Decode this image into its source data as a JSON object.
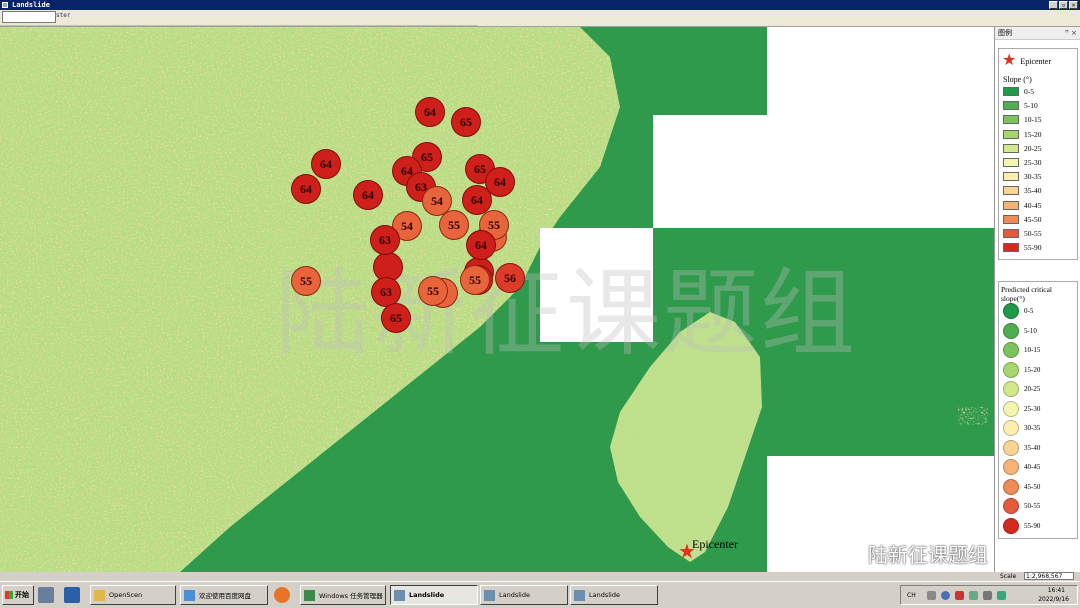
{
  "window": {
    "title": "Landslide",
    "controls": [
      "_",
      "▫",
      "×"
    ]
  },
  "toolbar": {
    "field_text": "ster"
  },
  "map": {
    "epicenter_label": "Epicenter",
    "watermark": "陆新征课题组",
    "brand": "陆新征课题组",
    "markers": [
      {
        "label": "64",
        "color": "#cf1f1a"
      },
      {
        "label": "65",
        "color": "#cf1f1a"
      },
      {
        "label": "65",
        "color": "#cf1f1a"
      },
      {
        "label": "64",
        "color": "#cf1f1a"
      },
      {
        "label": "64",
        "color": "#cf1f1a"
      },
      {
        "label": "65",
        "color": "#cf1f1a"
      },
      {
        "label": "64",
        "color": "#cf1f1a"
      },
      {
        "label": "64",
        "color": "#cf1f1a"
      },
      {
        "label": "64",
        "color": "#cf1f1a"
      },
      {
        "label": "63",
        "color": "#cf1f1a"
      },
      {
        "label": "54",
        "color": "#e8643a"
      },
      {
        "label": "64",
        "color": "#cf1f1a"
      },
      {
        "label": "54",
        "color": "#e8643a"
      },
      {
        "label": "55",
        "color": "#e8643a"
      },
      {
        "label": "55",
        "color": "#e8643a"
      },
      {
        "label": "63",
        "color": "#cf1f1a"
      },
      {
        "label": "64",
        "color": "#cf1f1a"
      },
      {
        "label": "55",
        "color": "#e8643a"
      },
      {
        "label": "55",
        "color": "#e8643a"
      },
      {
        "label": "56",
        "color": "#dd3a2a"
      },
      {
        "label": "63",
        "color": "#cf1f1a"
      },
      {
        "label": "55",
        "color": "#e8643a"
      },
      {
        "label": "65",
        "color": "#cf1f1a"
      }
    ]
  },
  "legend": {
    "panel_title": "图例",
    "panel_controls": "ꟸ ×",
    "epicenter_label": "Epicenter",
    "slope_title": "Slope (°)",
    "slope_items": [
      {
        "label": "0-5",
        "color": "#1e9a48"
      },
      {
        "label": "5-10",
        "color": "#4fae4f"
      },
      {
        "label": "10-15",
        "color": "#7cc35e"
      },
      {
        "label": "15-20",
        "color": "#a8d66e"
      },
      {
        "label": "20-25",
        "color": "#d2e88a"
      },
      {
        "label": "25-30",
        "color": "#f3f5b0"
      },
      {
        "label": "30-35",
        "color": "#fdefb0"
      },
      {
        "label": "35-40",
        "color": "#fbd393"
      },
      {
        "label": "40-45",
        "color": "#f6b277"
      },
      {
        "label": "45-50",
        "color": "#ee8b58"
      },
      {
        "label": "50-55",
        "color": "#e45a3c"
      },
      {
        "label": "55-90",
        "color": "#d42a22"
      }
    ],
    "pc_title": "Predicted critical slope(°)",
    "pc_items": [
      {
        "label": "0-5",
        "color": "#1e9a48"
      },
      {
        "label": "5-10",
        "color": "#4fae4f"
      },
      {
        "label": "10-15",
        "color": "#7cc35e"
      },
      {
        "label": "15-20",
        "color": "#a8d66e"
      },
      {
        "label": "20-25",
        "color": "#d2e88a"
      },
      {
        "label": "25-30",
        "color": "#f3f5b0"
      },
      {
        "label": "30-35",
        "color": "#fdefb0"
      },
      {
        "label": "35-40",
        "color": "#fbd393"
      },
      {
        "label": "40-45",
        "color": "#f6b277"
      },
      {
        "label": "45-50",
        "color": "#ee8b58"
      },
      {
        "label": "50-55",
        "color": "#e45a3c"
      },
      {
        "label": "55-90",
        "color": "#d42a22"
      }
    ]
  },
  "scale": {
    "label": "Scale",
    "value": "1:2,968,567"
  },
  "taskbar": {
    "start_label": "开始",
    "tasks": [
      {
        "label": "OpenScen",
        "icon": "folder-icon",
        "active": false
      },
      {
        "label": "欢迎使用百度网盘",
        "icon": "cloud-icon",
        "active": false
      },
      {
        "label": "Windows 任务管理器",
        "icon": "task-manager-icon",
        "active": false
      },
      {
        "label": "Landslide",
        "icon": "app-window-icon",
        "active": true
      },
      {
        "label": "Landslide",
        "icon": "app-window-icon",
        "active": false
      },
      {
        "label": "Landslide",
        "icon": "app-window-icon",
        "active": false
      }
    ],
    "tray": {
      "lang": "CH",
      "time": "16:41",
      "date": "2022/9/16"
    }
  }
}
